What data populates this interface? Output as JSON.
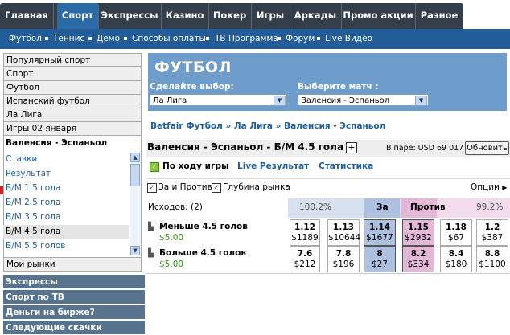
{
  "nav": {
    "tabs": [
      "Главная",
      "Спорт",
      "Экспрессы",
      "Казино",
      "Покер",
      "Игры",
      "Аркады",
      "Промо акции",
      "Разное"
    ],
    "active_tab": "Спорт",
    "sub": [
      "Футбол",
      "Теннис",
      "Демо",
      "Способы оплаты",
      "ТВ Программа",
      "Форум",
      "Live Видео"
    ]
  },
  "left": {
    "rows_top": [
      "Популярный спорт",
      "Спорт",
      "Футбол",
      "Испанский футбол",
      "Ла Лига",
      "Игры 02 января"
    ],
    "selected_event": "Валенсия - Эспаньол",
    "markets": [
      "Ставки",
      "Результат",
      "Б/М 1.5 гола",
      "Б/М 2.5 гола",
      "Б/М 3.5 гола",
      "Б/М 4.5 гола",
      "Б/М 5.5 голов"
    ],
    "active_market": "Б/М 4.5 гола",
    "my_markets": "Мои рынки",
    "sections": [
      "Экспрессы",
      "Спорт по ТВ",
      "Деньги на бирже?",
      "Следующие скачки"
    ]
  },
  "hero": {
    "title": "ФУТБОЛ",
    "choose_label": "Сделайте выбор:",
    "choose_value": "Ла Лига",
    "match_label": "Выберите матч :",
    "match_value": "Валенсия - Эспаньол"
  },
  "breadcrumb": "Betfair Футбол » Ла Лига » Валенсия - Эспаньол",
  "market": {
    "title": "Валенсия - Эспаньол - Б/М 4.5 гола",
    "plus": "+",
    "matched": "В паре: USD 69 017",
    "refresh": "Обновить",
    "inplay": "По ходу игры",
    "live": "Live Результат",
    "stats": "Статистика",
    "chk_for_against": "За и Против",
    "chk_depth": "Глубина рынка",
    "options": "Опции",
    "outcomes": "Исходов: (2)",
    "back_pct": "100.2%",
    "back_label": "За",
    "lay_label": "Против",
    "lay_pct": "99.2%",
    "runners": [
      {
        "name": "Меньше 4.5 голов",
        "pl": "$5.00",
        "back": [
          {
            "o": "1.12",
            "v": "$1189"
          },
          {
            "o": "1.13",
            "v": "$10644"
          },
          {
            "o": "1.14",
            "v": "$1677"
          }
        ],
        "lay": [
          {
            "o": "1.15",
            "v": "$2932"
          },
          {
            "o": "1.18",
            "v": "$67"
          },
          {
            "o": "1.2",
            "v": "$387"
          }
        ]
      },
      {
        "name": "Больше 4.5 голов",
        "pl": "$5.00",
        "back": [
          {
            "o": "7.6",
            "v": "$212"
          },
          {
            "o": "7.8",
            "v": "$196"
          },
          {
            "o": "8",
            "v": "$27"
          }
        ],
        "lay": [
          {
            "o": "8.2",
            "v": "$334"
          },
          {
            "o": "8.4",
            "v": "$180"
          },
          {
            "o": "8.8",
            "v": "$1100"
          }
        ]
      }
    ]
  },
  "colors": {
    "nav": "#333e4a",
    "active_tab": "#2a6ba7",
    "subnav": "#225d99",
    "hero": "#6e9ccb",
    "back": "#aec0df",
    "lay": "#e3b7d6",
    "back_soft": "#d8e1f0",
    "lay_soft": "#f2dcec"
  }
}
